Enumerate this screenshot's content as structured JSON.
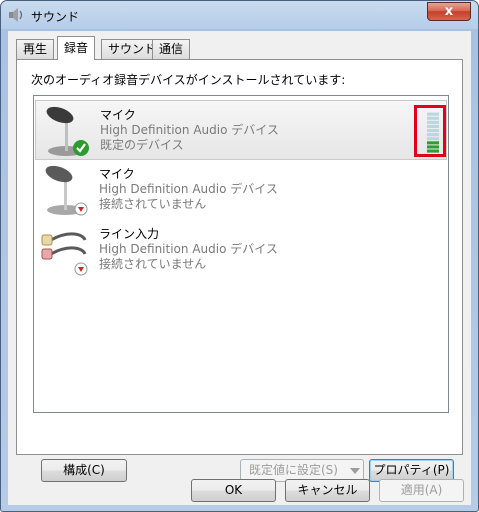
{
  "window": {
    "title": "サウンド",
    "close_label": "x"
  },
  "tabs": [
    {
      "label": "再生",
      "active": false
    },
    {
      "label": "録音",
      "active": true
    },
    {
      "label": "サウンド",
      "active": false
    },
    {
      "label": "通信",
      "active": false
    }
  ],
  "panel": {
    "caption": "次のオーディオ録音デバイスがインストールされています:",
    "devices": [
      {
        "name": "マイク",
        "description": "High Definition Audio デバイス",
        "status": "既定のデバイス",
        "icon": "microphone-icon",
        "badge": "default-checkmark-icon",
        "selected": true,
        "level": 0.3
      },
      {
        "name": "マイク",
        "description": "High Definition Audio デバイス",
        "status": "接続されていません",
        "icon": "microphone-icon",
        "badge": "unplugged-icon",
        "selected": false
      },
      {
        "name": "ライン入力",
        "description": "High Definition Audio デバイス",
        "status": "接続されていません",
        "icon": "line-in-cable-icon",
        "badge": "unplugged-icon",
        "selected": false
      }
    ]
  },
  "buttons": {
    "configure": "構成(C)",
    "set_default": "既定値に設定(S)",
    "properties": "プロパティ(P)",
    "ok": "OK",
    "cancel": "キャンセル",
    "apply": "適用(A)"
  },
  "colors": {
    "highlight": "#e2001a",
    "meter_on": "#2f9e2f",
    "meter_off": "#bcd6e0"
  }
}
